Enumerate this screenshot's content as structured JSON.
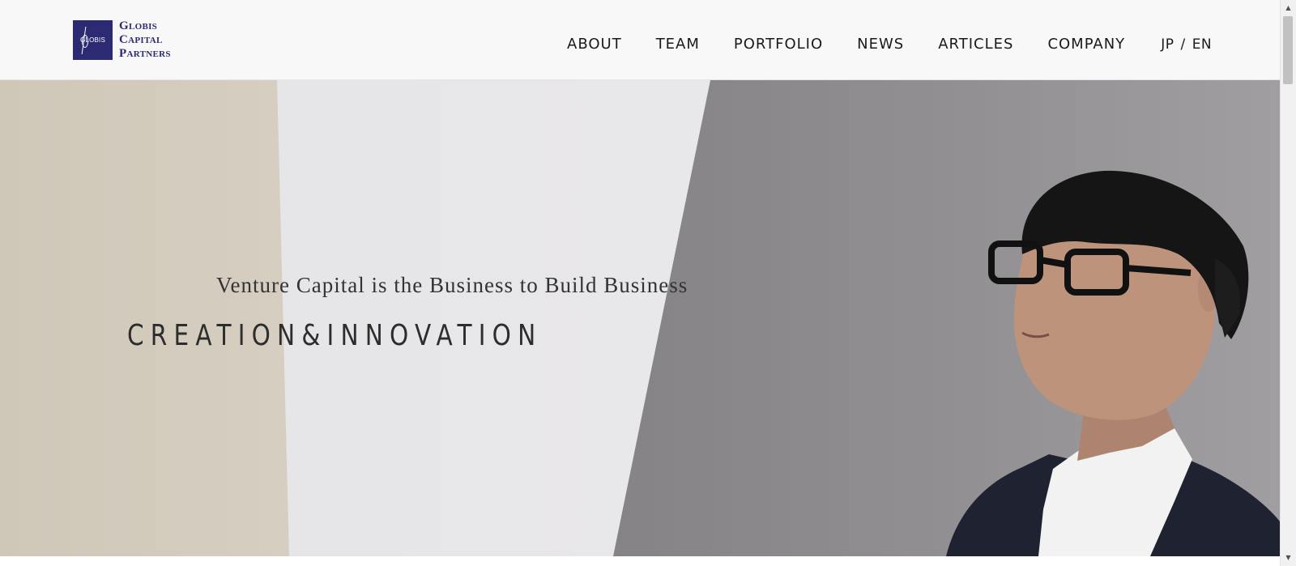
{
  "header": {
    "logo": {
      "mark_text": "GLOBIS",
      "lines": [
        "Globis",
        "Capital",
        "Partners"
      ],
      "brand_color": "#2c2a73"
    },
    "nav": [
      {
        "label": "ABOUT"
      },
      {
        "label": "TEAM"
      },
      {
        "label": "PORTFOLIO"
      },
      {
        "label": "NEWS"
      },
      {
        "label": "ARTICLES"
      },
      {
        "label": "COMPANY"
      }
    ],
    "lang": {
      "jp": "JP",
      "separator": "/",
      "en": "EN"
    }
  },
  "hero": {
    "tagline": "Venture Capital is the Business to Build Business",
    "headline": "CREATION&INNOVATION",
    "colors": {
      "beige_panel": "#d2cbbd",
      "light_panel": "#e9e8ea",
      "gray_panel": "#8e8c8f",
      "suit": "#1f2230",
      "shirt": "#f3f3f3",
      "skin": "#b98f79",
      "hair": "#151515"
    }
  },
  "scrollbar": {
    "up_icon": "chevron-up-icon",
    "down_icon": "chevron-down-icon"
  }
}
